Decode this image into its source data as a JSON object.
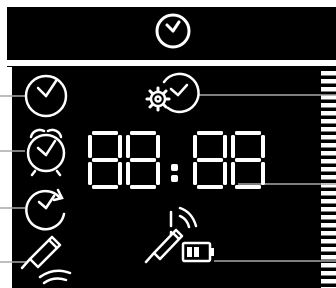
{
  "display": {
    "digits": [
      "8",
      "8",
      "8",
      "8"
    ],
    "separator": ":"
  },
  "icons": {
    "header": "clock-icon",
    "left_column": [
      "clock-icon",
      "alarm-clock-icon",
      "clock-sync-icon",
      "wireless-pen-icon"
    ],
    "top_right": "clock-settings-icon",
    "bottom_right": [
      "wireless-pen-alert-icon",
      "battery-icon",
      "wireless-signal-icon"
    ]
  },
  "battery": {
    "level_fraction": 0.67
  },
  "colors": {
    "background": "#ffffff",
    "header_bar": "#000000",
    "panel": "#000000",
    "foreground": "#ffffff",
    "leader_lines": "#a8a8a8"
  }
}
